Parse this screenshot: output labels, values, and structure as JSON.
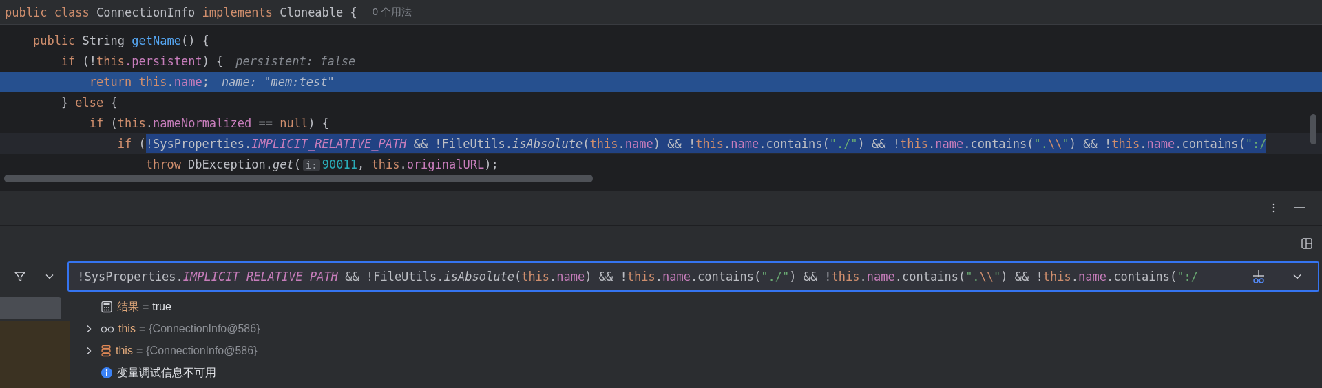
{
  "editor": {
    "header": {
      "tokens": [
        {
          "text": "public class ",
          "kind": "keyword"
        },
        {
          "text": "ConnectionInfo ",
          "kind": "plain"
        },
        {
          "text": "implements ",
          "kind": "keyword"
        },
        {
          "text": "Cloneable {",
          "kind": "plain"
        }
      ],
      "usages": "0 个用法"
    },
    "lines": [
      {
        "current": false,
        "tokens": [
          {
            "text": "    public ",
            "kind": "keyword"
          },
          {
            "text": "String ",
            "kind": "plain"
          },
          {
            "text": "getName",
            "kind": "method_decl"
          },
          {
            "text": "() {",
            "kind": "plain"
          }
        ]
      },
      {
        "current": false,
        "tokens": [
          {
            "text": "        if",
            "kind": "keyword"
          },
          {
            "text": " (!",
            "kind": "plain"
          },
          {
            "text": "this",
            "kind": "keyword"
          },
          {
            "text": ".persistent",
            "kind": "field"
          },
          {
            "text": ") {",
            "kind": "plain"
          },
          {
            "text": "persistent: false",
            "kind": "hint"
          }
        ]
      },
      {
        "current": true,
        "tokens": [
          {
            "text": "            return ",
            "kind": "keyword"
          },
          {
            "text": "this",
            "kind": "keyword"
          },
          {
            "text": ".",
            "kind": "plain"
          },
          {
            "text": "name",
            "kind": "field"
          },
          {
            "text": ";",
            "kind": "plain"
          },
          {
            "text": "name: \"mem:test\"",
            "kind": "hint"
          }
        ]
      },
      {
        "current": false,
        "tokens": [
          {
            "text": "        } ",
            "kind": "plain"
          },
          {
            "text": "else",
            "kind": "keyword"
          },
          {
            "text": " {",
            "kind": "plain"
          }
        ]
      },
      {
        "current": false,
        "tokens": [
          {
            "text": "            if",
            "kind": "keyword"
          },
          {
            "text": " (",
            "kind": "plain"
          },
          {
            "text": "this",
            "kind": "keyword"
          },
          {
            "text": ".",
            "kind": "plain"
          },
          {
            "text": "nameNormalized",
            "kind": "field"
          },
          {
            "text": " == ",
            "kind": "plain"
          },
          {
            "text": "null",
            "kind": "keyword"
          },
          {
            "text": ") {",
            "kind": "plain"
          }
        ]
      },
      {
        "current": false,
        "tokens": [
          {
            "text": "                if",
            "kind": "keyword"
          },
          {
            "text": " (",
            "kind": "plain"
          }
        ],
        "selection": [
          {
            "text": "!SysProperties.",
            "kind": "plain"
          },
          {
            "text": "IMPLICIT_RELATIVE_PATH",
            "kind": "static_const"
          },
          {
            "text": " && !FileUtils.",
            "kind": "plain"
          },
          {
            "text": "isAbsolute",
            "kind": "static_call"
          },
          {
            "text": "(",
            "kind": "plain"
          },
          {
            "text": "this",
            "kind": "keyword"
          },
          {
            "text": ".",
            "kind": "plain"
          },
          {
            "text": "name",
            "kind": "field"
          },
          {
            "text": ") && !",
            "kind": "plain"
          },
          {
            "text": "this",
            "kind": "keyword"
          },
          {
            "text": ".",
            "kind": "plain"
          },
          {
            "text": "name",
            "kind": "field"
          },
          {
            "text": ".contains(",
            "kind": "plain"
          },
          {
            "text": "\"./\"",
            "kind": "string"
          },
          {
            "text": ") && !",
            "kind": "plain"
          },
          {
            "text": "this",
            "kind": "keyword"
          },
          {
            "text": ".",
            "kind": "plain"
          },
          {
            "text": "name",
            "kind": "field"
          },
          {
            "text": ".contains(",
            "kind": "plain"
          },
          {
            "text": "\".",
            "kind": "string"
          },
          {
            "text": "\\\\",
            "kind": "keyword"
          },
          {
            "text": "\"",
            "kind": "string"
          },
          {
            "text": ") && !",
            "kind": "plain"
          },
          {
            "text": "this",
            "kind": "keyword"
          },
          {
            "text": ".",
            "kind": "plain"
          },
          {
            "text": "name",
            "kind": "field"
          },
          {
            "text": ".contains(",
            "kind": "plain"
          },
          {
            "text": "\":/",
            "kind": "string"
          }
        ]
      },
      {
        "current": false,
        "tokens": [
          {
            "text": "                    throw ",
            "kind": "keyword"
          },
          {
            "text": "DbException.",
            "kind": "plain"
          },
          {
            "text": "get",
            "kind": "static_call"
          },
          {
            "text": "(",
            "kind": "plain"
          },
          {
            "text": "i:",
            "kind": "param_hint"
          },
          {
            "text": "90011",
            "kind": "number"
          },
          {
            "text": ", ",
            "kind": "plain"
          },
          {
            "text": "this",
            "kind": "keyword"
          },
          {
            "text": ".",
            "kind": "plain"
          },
          {
            "text": "originalURL",
            "kind": "field"
          },
          {
            "text": ");",
            "kind": "plain"
          }
        ]
      }
    ]
  },
  "evaluate": {
    "tokens": [
      {
        "text": "!SysProperties.",
        "kind": "plain"
      },
      {
        "text": "IMPLICIT_RELATIVE_PATH",
        "kind": "static_const"
      },
      {
        "text": " && !FileUtils.",
        "kind": "plain"
      },
      {
        "text": "isAbsolute",
        "kind": "static_call"
      },
      {
        "text": "(",
        "kind": "plain"
      },
      {
        "text": "this",
        "kind": "keyword"
      },
      {
        "text": ".",
        "kind": "plain"
      },
      {
        "text": "name",
        "kind": "field"
      },
      {
        "text": ") && !",
        "kind": "plain"
      },
      {
        "text": "this",
        "kind": "keyword"
      },
      {
        "text": ".",
        "kind": "plain"
      },
      {
        "text": "name",
        "kind": "field"
      },
      {
        "text": ".contains(",
        "kind": "plain"
      },
      {
        "text": "\"./\"",
        "kind": "string"
      },
      {
        "text": ") && !",
        "kind": "plain"
      },
      {
        "text": "this",
        "kind": "keyword"
      },
      {
        "text": ".",
        "kind": "plain"
      },
      {
        "text": "name",
        "kind": "field"
      },
      {
        "text": ".contains(",
        "kind": "plain"
      },
      {
        "text": "\".",
        "kind": "string"
      },
      {
        "text": "\\\\",
        "kind": "keyword"
      },
      {
        "text": "\"",
        "kind": "string"
      },
      {
        "text": ") && !",
        "kind": "plain"
      },
      {
        "text": "this",
        "kind": "keyword"
      },
      {
        "text": ".",
        "kind": "plain"
      },
      {
        "text": "name",
        "kind": "field"
      },
      {
        "text": ".contains(",
        "kind": "plain"
      },
      {
        "text": "\":/",
        "kind": "string"
      }
    ]
  },
  "variables": [
    {
      "kind": "result",
      "name": "结果",
      "operator": "=",
      "value": "true"
    },
    {
      "kind": "watch",
      "name": "this",
      "operator": "=",
      "value": "{ConnectionInfo@586}",
      "expanded": false
    },
    {
      "kind": "field",
      "name": "this",
      "operator": "=",
      "value": "{ConnectionInfo@586}",
      "expanded": false
    },
    {
      "kind": "info",
      "text": "变量调试信息不可用"
    }
  ]
}
